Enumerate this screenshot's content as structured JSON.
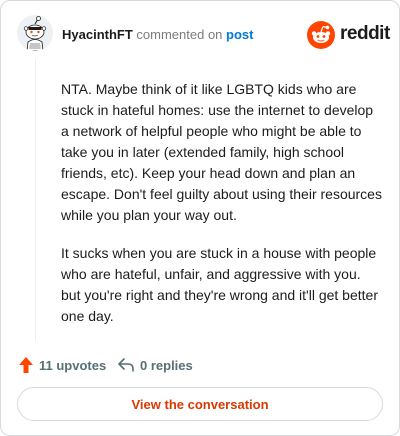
{
  "header": {
    "username": "HyacinthFT",
    "commented_text": "commented on",
    "post_link": "post",
    "brand": "reddit"
  },
  "comment": {
    "paragraphs": [
      "NTA. Maybe think of it like LGBTQ kids who are stuck in hateful homes: use the internet to develop a network of helpful people who might be able to take you in later (extended family, high school friends, etc). Keep your head down and plan an escape. Don't feel guilty about using their resources while you plan your way out.",
      "It sucks when you are stuck in a house with people who are hateful, unfair, and aggressive with you. but you're right and they're wrong and it'll get better one day."
    ]
  },
  "actions": {
    "upvotes": "11 upvotes",
    "replies": "0 replies"
  },
  "footer": {
    "view_button": "View the conversation"
  },
  "colors": {
    "reddit_orange": "#ff4500",
    "link_blue": "#0079d3",
    "button_text": "#d93900",
    "muted": "#576f76"
  }
}
